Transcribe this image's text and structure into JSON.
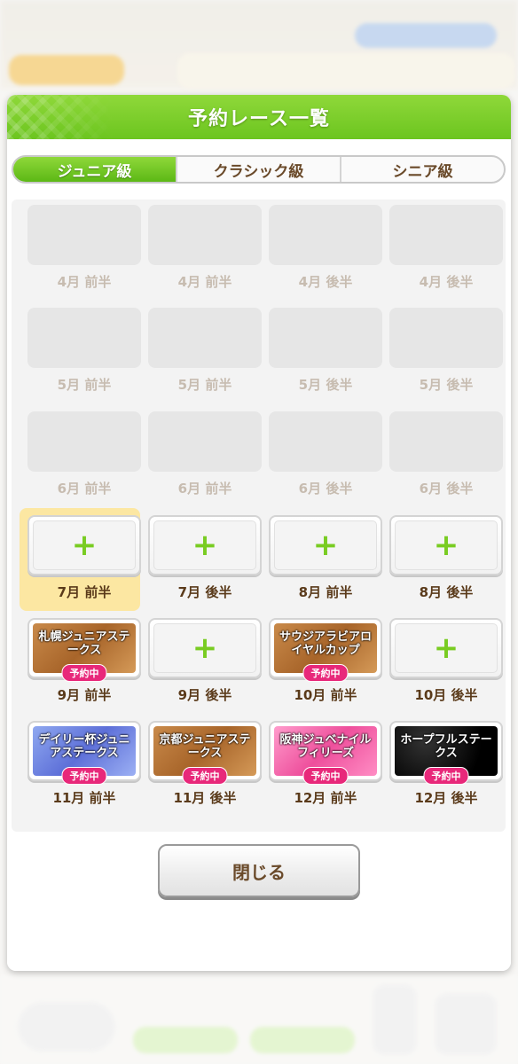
{
  "dialog": {
    "title": "予約レース一覧",
    "close_label": "閉じる"
  },
  "tabs": [
    {
      "label": "ジュニア級",
      "active": true
    },
    {
      "label": "クラシック級",
      "active": false
    },
    {
      "label": "シニア級",
      "active": false
    }
  ],
  "slots": [
    {
      "label": "4月 前半",
      "state": "disabled"
    },
    {
      "label": "4月 前半",
      "state": "disabled"
    },
    {
      "label": "4月 後半",
      "state": "disabled"
    },
    {
      "label": "4月 後半",
      "state": "disabled"
    },
    {
      "label": "5月 前半",
      "state": "disabled"
    },
    {
      "label": "5月 前半",
      "state": "disabled"
    },
    {
      "label": "5月 後半",
      "state": "disabled"
    },
    {
      "label": "5月 後半",
      "state": "disabled"
    },
    {
      "label": "6月 前半",
      "state": "disabled"
    },
    {
      "label": "6月 前半",
      "state": "disabled"
    },
    {
      "label": "6月 後半",
      "state": "disabled"
    },
    {
      "label": "6月 後半",
      "state": "disabled"
    },
    {
      "label": "7月 前半",
      "state": "add",
      "selected": true
    },
    {
      "label": "7月 後半",
      "state": "add"
    },
    {
      "label": "8月 前半",
      "state": "add"
    },
    {
      "label": "8月 後半",
      "state": "add"
    },
    {
      "label": "9月 前半",
      "state": "race",
      "race_name": "札幌ジュニアステークス",
      "style": "bronze",
      "badge": "予約中"
    },
    {
      "label": "9月 後半",
      "state": "add"
    },
    {
      "label": "10月 前半",
      "state": "race",
      "race_name": "サウジアラビアロイヤルカップ",
      "style": "bronze",
      "badge": "予約中"
    },
    {
      "label": "10月 後半",
      "state": "add"
    },
    {
      "label": "11月 前半",
      "state": "race",
      "race_name": "デイリー杯ジュニアステークス",
      "style": "blue",
      "badge": "予約中"
    },
    {
      "label": "11月 後半",
      "state": "race",
      "race_name": "京都ジュニアステークス",
      "style": "bronze",
      "badge": "予約中"
    },
    {
      "label": "12月 前半",
      "state": "race",
      "race_name": "阪神ジュベナイルフィリーズ",
      "style": "pink",
      "badge": "予約中"
    },
    {
      "label": "12月 後半",
      "state": "race",
      "race_name": "ホープフルステークス",
      "style": "black",
      "badge": "予約中"
    }
  ],
  "colors": {
    "accent_green": "#6cc51f",
    "badge_pink": "#e8287a",
    "selected_yellow": "#fce7a2"
  }
}
